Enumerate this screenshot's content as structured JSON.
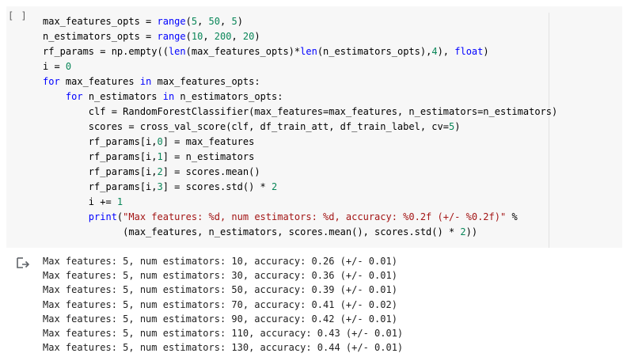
{
  "cell": {
    "run_indicator": "[ ]",
    "code_lines": [
      [
        [
          "t",
          "max_features_opts = "
        ],
        [
          "k",
          "range"
        ],
        [
          "t",
          "("
        ],
        [
          "n",
          "5"
        ],
        [
          "t",
          ", "
        ],
        [
          "n",
          "50"
        ],
        [
          "t",
          ", "
        ],
        [
          "n",
          "5"
        ],
        [
          "t",
          ")"
        ]
      ],
      [
        [
          "t",
          "n_estimators_opts = "
        ],
        [
          "k",
          "range"
        ],
        [
          "t",
          "("
        ],
        [
          "n",
          "10"
        ],
        [
          "t",
          ", "
        ],
        [
          "n",
          "200"
        ],
        [
          "t",
          ", "
        ],
        [
          "n",
          "20"
        ],
        [
          "t",
          ")"
        ]
      ],
      [
        [
          "t",
          "rf_params = np.empty(("
        ],
        [
          "k",
          "len"
        ],
        [
          "t",
          "(max_features_opts)*"
        ],
        [
          "k",
          "len"
        ],
        [
          "t",
          "(n_estimators_opts),"
        ],
        [
          "n",
          "4"
        ],
        [
          "t",
          "), "
        ],
        [
          "k",
          "float"
        ],
        [
          "t",
          ")"
        ]
      ],
      [
        [
          "t",
          "i = "
        ],
        [
          "n",
          "0"
        ]
      ],
      [
        [
          "k",
          "for"
        ],
        [
          "t",
          " max_features "
        ],
        [
          "k",
          "in"
        ],
        [
          "t",
          " max_features_opts:"
        ]
      ],
      [
        [
          "t",
          "    "
        ],
        [
          "k",
          "for"
        ],
        [
          "t",
          " n_estimators "
        ],
        [
          "k",
          "in"
        ],
        [
          "t",
          " n_estimators_opts:"
        ]
      ],
      [
        [
          "t",
          "        clf = RandomForestClassifier(max_features=max_features, n_estimators=n_estimators)"
        ]
      ],
      [
        [
          "t",
          "        scores = cross_val_score(clf, df_train_att, df_train_label, cv="
        ],
        [
          "n",
          "5"
        ],
        [
          "t",
          ")"
        ]
      ],
      [
        [
          "t",
          "        rf_params[i,"
        ],
        [
          "n",
          "0"
        ],
        [
          "t",
          "] = max_features"
        ]
      ],
      [
        [
          "t",
          "        rf_params[i,"
        ],
        [
          "n",
          "1"
        ],
        [
          "t",
          "] = n_estimators"
        ]
      ],
      [
        [
          "t",
          "        rf_params[i,"
        ],
        [
          "n",
          "2"
        ],
        [
          "t",
          "] = scores.mean()"
        ]
      ],
      [
        [
          "t",
          "        rf_params[i,"
        ],
        [
          "n",
          "3"
        ],
        [
          "t",
          "] = scores.std() * "
        ],
        [
          "n",
          "2"
        ]
      ],
      [
        [
          "t",
          "        i += "
        ],
        [
          "n",
          "1"
        ]
      ],
      [
        [
          "t",
          "        "
        ],
        [
          "k",
          "print"
        ],
        [
          "t",
          "("
        ],
        [
          "s",
          "\"Max features: %d, num estimators: %d, accuracy: %0.2f (+/- %0.2f)\""
        ],
        [
          "t",
          " %"
        ]
      ],
      [
        [
          "t",
          "              (max_features, n_estimators, scores.mean(), scores.std() * "
        ],
        [
          "n",
          "2"
        ],
        [
          "t",
          "))"
        ]
      ]
    ]
  },
  "output": {
    "icon": "output-arrow-icon",
    "lines": [
      "Max features: 5, num estimators: 10, accuracy: 0.26 (+/- 0.01)",
      "Max features: 5, num estimators: 30, accuracy: 0.36 (+/- 0.01)",
      "Max features: 5, num estimators: 50, accuracy: 0.39 (+/- 0.01)",
      "Max features: 5, num estimators: 70, accuracy: 0.41 (+/- 0.02)",
      "Max features: 5, num estimators: 90, accuracy: 0.42 (+/- 0.01)",
      "Max features: 5, num estimators: 110, accuracy: 0.43 (+/- 0.01)",
      "Max features: 5, num estimators: 130, accuracy: 0.44 (+/- 0.01)"
    ]
  },
  "colors": {
    "cell_background": "#f7f7f7",
    "keyword": "#0000ff",
    "number": "#098658",
    "string": "#a31515"
  }
}
